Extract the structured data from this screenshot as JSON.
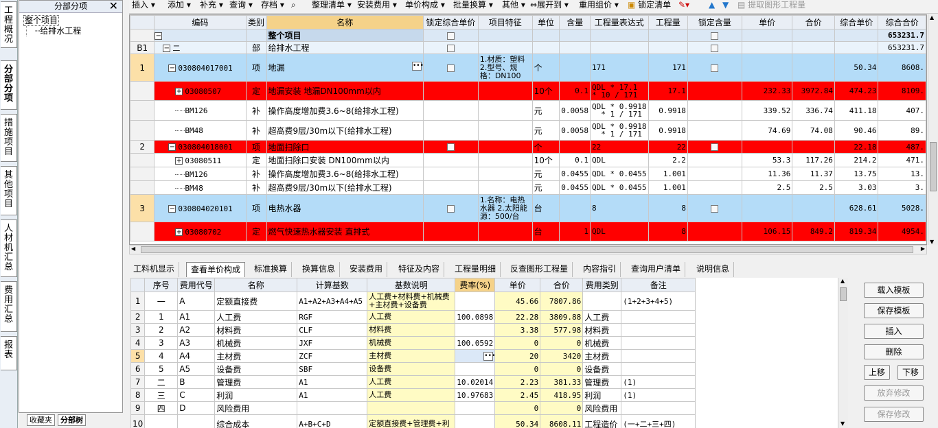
{
  "left_vtabs": [
    "工程概况",
    "分部分项",
    "措施项目",
    "其他项目",
    "人材机汇总",
    "费用汇总",
    "报表"
  ],
  "left_panel": {
    "title": "分部分项",
    "close": "✕",
    "tree_root": "整个项目",
    "tree_child": "给排水工程",
    "bottom_tabs": [
      "收藏夹",
      "分部树"
    ]
  },
  "toolbar": {
    "items": [
      "插入",
      "添加",
      "补充",
      "查询",
      "存档",
      "整理清单",
      "安装费用",
      "单价构成",
      "批量换算",
      "其他",
      "展开到",
      "重用组价",
      "锁定清单",
      "提取图形工程量"
    ]
  },
  "grid1": {
    "headers": [
      "编码",
      "类别",
      "名称",
      "锁定综合单价",
      "项目特征",
      "单位",
      "含量",
      "工程量表达式",
      "工程量",
      "锁定含量",
      "单价",
      "合价",
      "综合单价",
      "综合合价"
    ],
    "rows": [
      {
        "no": "",
        "code": "",
        "type": "",
        "name": "整个项目",
        "feat": "",
        "unit": "",
        "qty_ratio": "",
        "expr": "",
        "qty": "",
        "price": "",
        "total": "",
        "cprice": "",
        "ctotal": "653231.7",
        "style": "root"
      },
      {
        "no": "B1",
        "code": "二",
        "type": "部",
        "name": "给排水工程",
        "feat": "",
        "unit": "",
        "qty_ratio": "",
        "expr": "",
        "qty": "",
        "price": "",
        "total": "",
        "cprice": "",
        "ctotal": "653231.7",
        "style": "div"
      },
      {
        "no": "1",
        "code": "030804017001",
        "type": "项",
        "name": "地漏",
        "feat": "1.材质：塑料\n2.型号、规格：DN100",
        "unit": "个",
        "qty_ratio": "",
        "expr": "171",
        "qty": "171",
        "price": "",
        "total": "",
        "cprice": "50.34",
        "ctotal": "8608.",
        "style": "item"
      },
      {
        "no": "",
        "code": "03080507",
        "type": "定",
        "name": "地漏安装 地漏DN100mm以内",
        "feat": "",
        "unit": "10个",
        "qty_ratio": "0.1",
        "expr": "QDL * 17.1\n* 10 / 171",
        "qty": "17.1",
        "price": "232.33",
        "total": "3972.84",
        "cprice": "474.23",
        "ctotal": "8109.",
        "style": "red"
      },
      {
        "no": "",
        "code": "BM126",
        "type": "补",
        "name": "操作高度增加费3.6~8(给排水工程)",
        "feat": "",
        "unit": "元",
        "qty_ratio": "0.0058",
        "expr": "QDL * 0.9918\n  * 1 / 171",
        "qty": "0.9918",
        "price": "339.52",
        "total": "336.74",
        "cprice": "411.18",
        "ctotal": "407.",
        "style": "sub"
      },
      {
        "no": "",
        "code": "BM48",
        "type": "补",
        "name": "超高费9层/30m以下(给排水工程)",
        "feat": "",
        "unit": "元",
        "qty_ratio": "0.0058",
        "expr": "QDL * 0.9918\n  * 1 / 171",
        "qty": "0.9918",
        "price": "74.69",
        "total": "74.08",
        "cprice": "90.46",
        "ctotal": "89.",
        "style": "sub"
      },
      {
        "no": "2",
        "code": "030804018001",
        "type": "项",
        "name": "地面扫除口",
        "feat": "",
        "unit": "个",
        "qty_ratio": "",
        "expr": "22",
        "qty": "22",
        "price": "",
        "total": "",
        "cprice": "22.18",
        "ctotal": "487.",
        "style": "redhead"
      },
      {
        "no": "",
        "code": "03080511",
        "type": "定",
        "name": "地面扫除口安装 DN100mm以内",
        "feat": "",
        "unit": "10个",
        "qty_ratio": "0.1",
        "expr": "QDL",
        "qty": "2.2",
        "price": "53.3",
        "total": "117.26",
        "cprice": "214.2",
        "ctotal": "471.",
        "style": "sub"
      },
      {
        "no": "",
        "code": "BM126",
        "type": "补",
        "name": "操作高度增加费3.6~8(给排水工程)",
        "feat": "",
        "unit": "元",
        "qty_ratio": "0.0455",
        "expr": "QDL * 0.0455",
        "qty": "1.001",
        "price": "11.36",
        "total": "11.37",
        "cprice": "13.75",
        "ctotal": "13.",
        "style": "sub"
      },
      {
        "no": "",
        "code": "BM48",
        "type": "补",
        "name": "超高费9层/30m以下(给排水工程)",
        "feat": "",
        "unit": "元",
        "qty_ratio": "0.0455",
        "expr": "QDL * 0.0455",
        "qty": "1.001",
        "price": "2.5",
        "total": "2.5",
        "cprice": "3.03",
        "ctotal": "3.",
        "style": "sub"
      },
      {
        "no": "3",
        "code": "030804020101",
        "type": "项",
        "name": "电热水器",
        "feat": "1.名称：电热水器\n2.太阳能源：500/台",
        "unit": "台",
        "qty_ratio": "",
        "expr": "8",
        "qty": "8",
        "price": "",
        "total": "",
        "cprice": "628.61",
        "ctotal": "5028.",
        "style": "item"
      },
      {
        "no": "",
        "code": "03080702",
        "type": "定",
        "name": "燃气快速热水器安装 直排式",
        "feat": "",
        "unit": "台",
        "qty_ratio": "1",
        "expr": "QDL",
        "qty": "8",
        "price": "106.15",
        "total": "849.2",
        "cprice": "819.34",
        "ctotal": "4954.",
        "style": "red"
      }
    ]
  },
  "tabs2": [
    "工料机显示",
    "查看单价构成",
    "标准换算",
    "换算信息",
    "安装费用",
    "特征及内容",
    "工程量明细",
    "反查图形工程量",
    "内容指引",
    "查询用户清单",
    "说明信息"
  ],
  "grid2": {
    "headers": [
      "序号",
      "费用代号",
      "名称",
      "计算基数",
      "基数说明",
      "费率(%)",
      "单价",
      "合价",
      "费用类别",
      "备注"
    ],
    "rows": [
      {
        "i": "1",
        "seq": "一",
        "code": "A",
        "name": "定额直接费",
        "base": "A1+A2+A3+A4+A5",
        "desc": "人工费+材料费+机械费+主材费+设备费",
        "rate": "",
        "price": "45.66",
        "total": "7807.86",
        "cat": "",
        "note": "(1+2+3+4+5)"
      },
      {
        "i": "2",
        "seq": "1",
        "code": "A1",
        "name": "人工费",
        "base": "RGF",
        "desc": "人工费",
        "rate": "100.0898",
        "price": "22.28",
        "total": "3809.88",
        "cat": "人工费",
        "note": ""
      },
      {
        "i": "3",
        "seq": "2",
        "code": "A2",
        "name": "材料费",
        "base": "CLF",
        "desc": "材料费",
        "rate": "",
        "price": "3.38",
        "total": "577.98",
        "cat": "材料费",
        "note": ""
      },
      {
        "i": "4",
        "seq": "3",
        "code": "A3",
        "name": "机械费",
        "base": "JXF",
        "desc": "机械费",
        "rate": "100.0592",
        "price": "0",
        "total": "0",
        "cat": "机械费",
        "note": ""
      },
      {
        "i": "5",
        "seq": "4",
        "code": "A4",
        "name": "主材费",
        "base": "ZCF",
        "desc": "主材费",
        "rate": "",
        "price": "20",
        "total": "3420",
        "cat": "主材费",
        "note": ""
      },
      {
        "i": "6",
        "seq": "5",
        "code": "A5",
        "name": "设备费",
        "base": "SBF",
        "desc": "设备费",
        "rate": "",
        "price": "0",
        "total": "0",
        "cat": "设备费",
        "note": ""
      },
      {
        "i": "7",
        "seq": "二",
        "code": "B",
        "name": "管理费",
        "base": "A1",
        "desc": "人工费",
        "rate": "10.02014",
        "price": "2.23",
        "total": "381.33",
        "cat": "管理费",
        "note": "(1)"
      },
      {
        "i": "8",
        "seq": "三",
        "code": "C",
        "name": "利润",
        "base": "A1",
        "desc": "人工费",
        "rate": "10.97683",
        "price": "2.45",
        "total": "418.95",
        "cat": "利润",
        "note": "(1)"
      },
      {
        "i": "9",
        "seq": "四",
        "code": "D",
        "name": "风险费用",
        "base": "",
        "desc": "",
        "rate": "",
        "price": "0",
        "total": "0",
        "cat": "风险费用",
        "note": ""
      },
      {
        "i": "10",
        "seq": "",
        "code": "",
        "name": "综合成本",
        "base": "A+B+C+D",
        "desc": "定额直接费+管理费+利",
        "rate": "",
        "price": "50.34",
        "total": "8608.11",
        "cat": "工程造价",
        "note": "(一+二+三+四)"
      }
    ]
  },
  "side_buttons": [
    "载入模板",
    "保存模板",
    "插入",
    "删除",
    "上移",
    "下移",
    "放弃修改",
    "保存修改"
  ]
}
